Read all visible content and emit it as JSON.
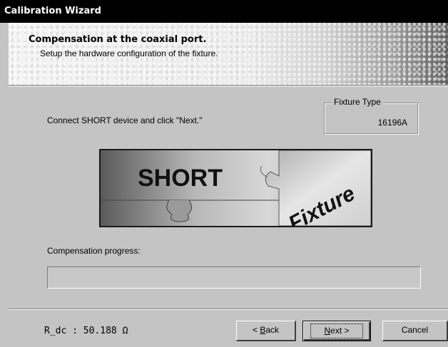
{
  "window": {
    "title": "Calibration Wizard"
  },
  "header": {
    "title": "Compensation at the coaxial port.",
    "subtitle": "Setup the hardware configuration of the fixture."
  },
  "instruction": "Connect SHORT device and click \"Next.\"",
  "fixture_type": {
    "label": "Fixture Type",
    "value": "16196A"
  },
  "diagram": {
    "short_label": "SHORT",
    "fixture_label": "Fixture"
  },
  "progress": {
    "label": "Compensation progress:",
    "fraction": 0
  },
  "status": {
    "rdc": "R_dc :  50.188 Ω"
  },
  "buttons": {
    "back": {
      "underlined": "B",
      "rest": "ack",
      "prefix": "< "
    },
    "next": {
      "underlined": "N",
      "rest": "ext >"
    },
    "cancel": "Cancel"
  },
  "colors": {
    "titlebar": "#000000",
    "dialog": "#c4c4c4",
    "progress_fill": "#000080"
  }
}
